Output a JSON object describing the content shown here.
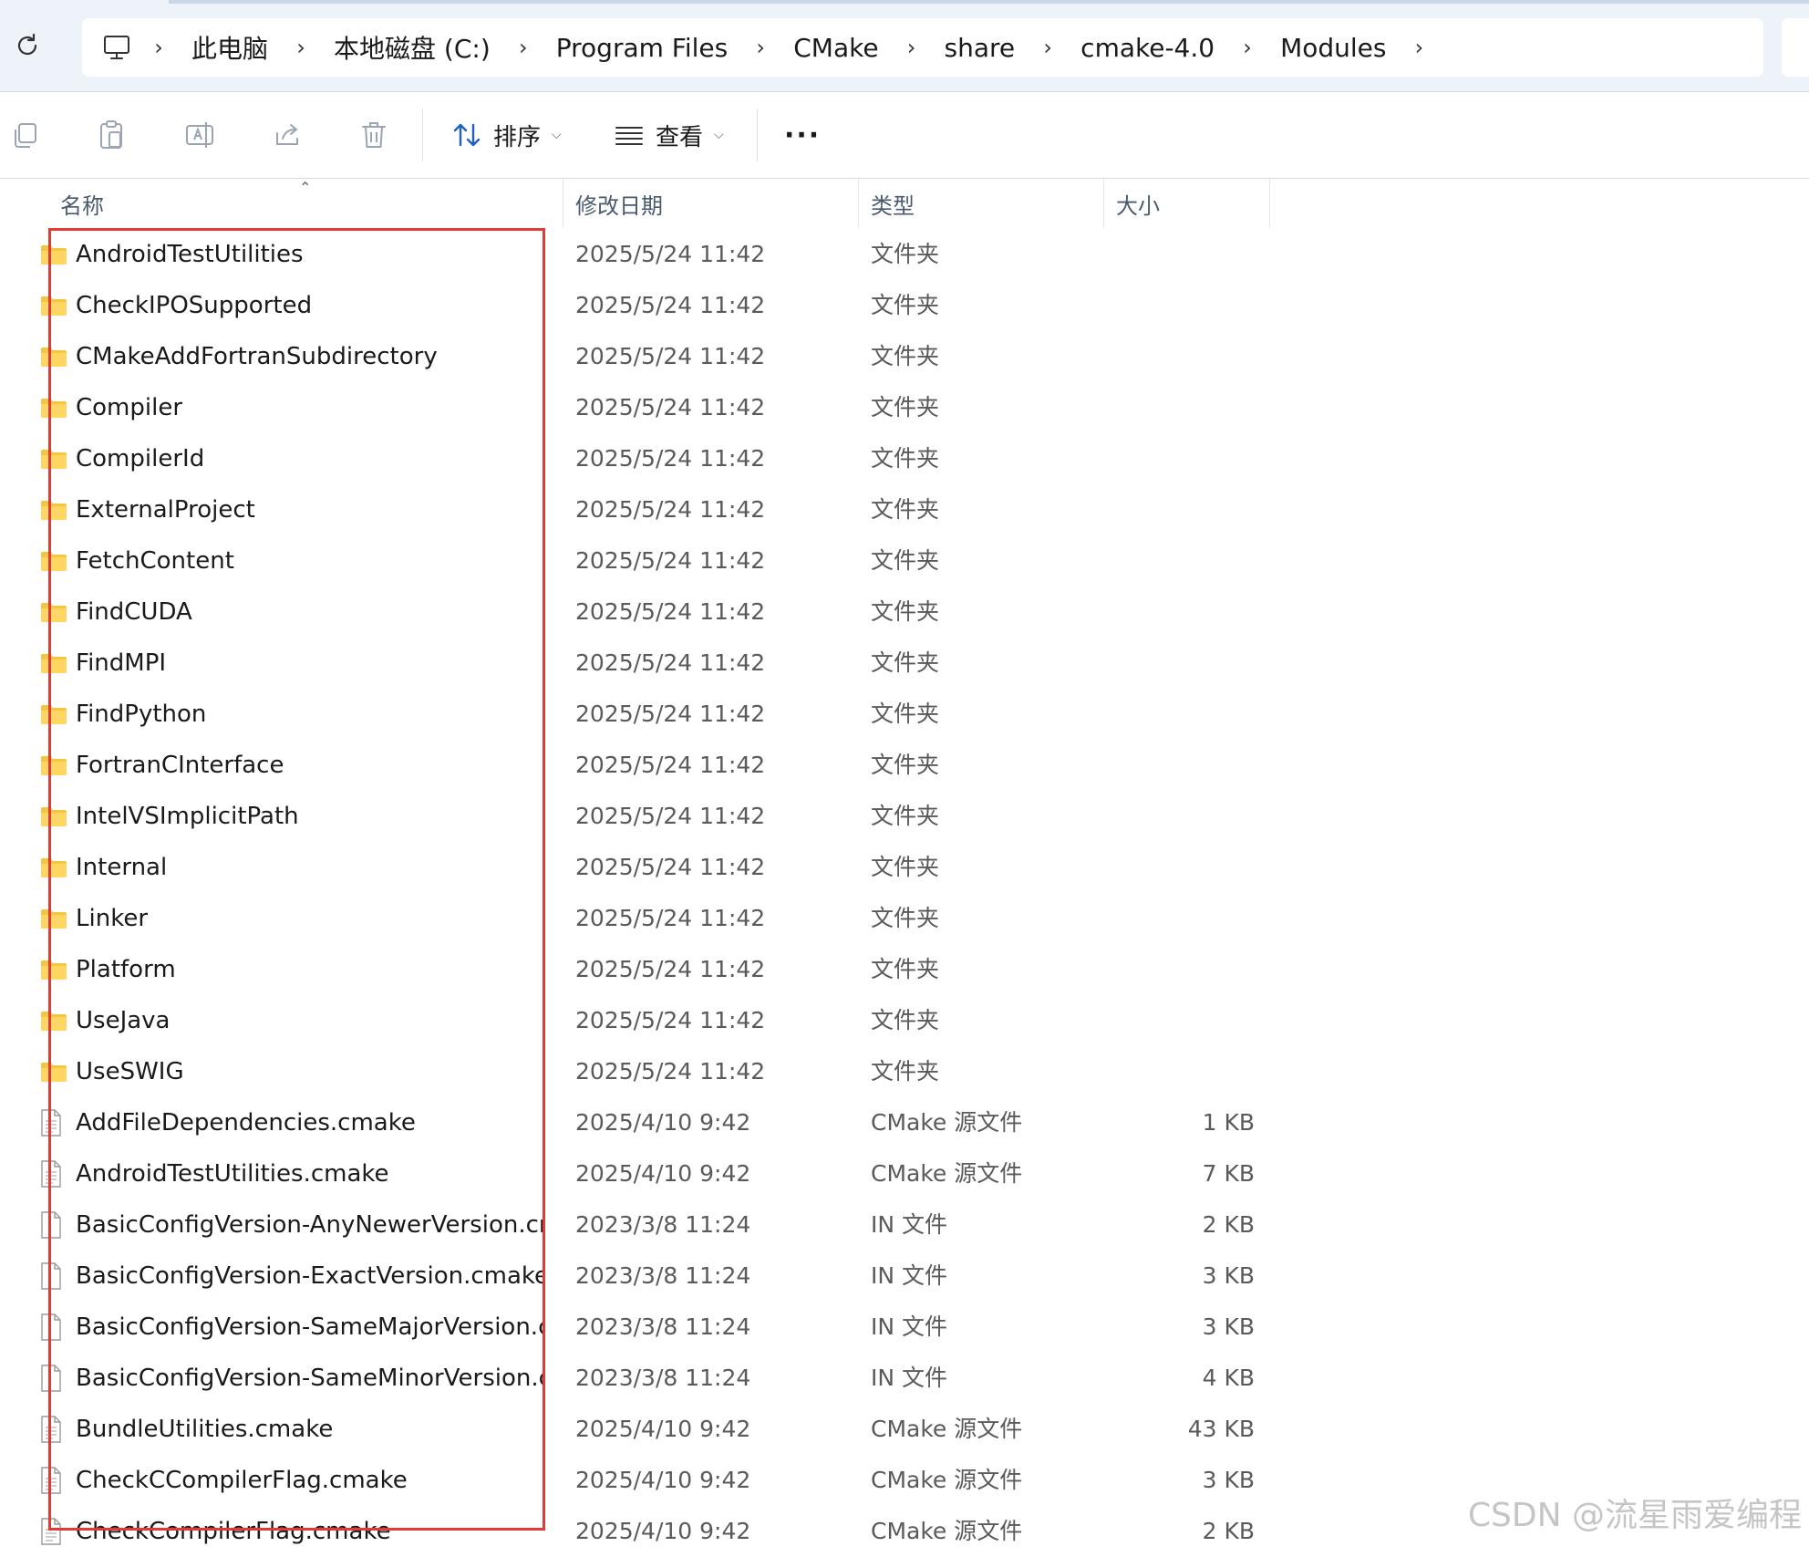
{
  "address": {
    "crumbs": [
      "此电脑",
      "本地磁盘 (C:)",
      "Program Files",
      "CMake",
      "share",
      "cmake-4.0",
      "Modules"
    ]
  },
  "toolbar": {
    "sort_label": "排序",
    "view_label": "查看"
  },
  "columns": {
    "name": "名称",
    "date": "修改日期",
    "type": "类型",
    "size": "大小"
  },
  "files": [
    {
      "name": "AndroidTestUtilities",
      "date": "2025/5/24 11:42",
      "type": "文件夹",
      "size": "",
      "kind": "folder"
    },
    {
      "name": "CheckIPOSupported",
      "date": "2025/5/24 11:42",
      "type": "文件夹",
      "size": "",
      "kind": "folder"
    },
    {
      "name": "CMakeAddFortranSubdirectory",
      "date": "2025/5/24 11:42",
      "type": "文件夹",
      "size": "",
      "kind": "folder"
    },
    {
      "name": "Compiler",
      "date": "2025/5/24 11:42",
      "type": "文件夹",
      "size": "",
      "kind": "folder"
    },
    {
      "name": "CompilerId",
      "date": "2025/5/24 11:42",
      "type": "文件夹",
      "size": "",
      "kind": "folder"
    },
    {
      "name": "ExternalProject",
      "date": "2025/5/24 11:42",
      "type": "文件夹",
      "size": "",
      "kind": "folder"
    },
    {
      "name": "FetchContent",
      "date": "2025/5/24 11:42",
      "type": "文件夹",
      "size": "",
      "kind": "folder"
    },
    {
      "name": "FindCUDA",
      "date": "2025/5/24 11:42",
      "type": "文件夹",
      "size": "",
      "kind": "folder"
    },
    {
      "name": "FindMPI",
      "date": "2025/5/24 11:42",
      "type": "文件夹",
      "size": "",
      "kind": "folder"
    },
    {
      "name": "FindPython",
      "date": "2025/5/24 11:42",
      "type": "文件夹",
      "size": "",
      "kind": "folder"
    },
    {
      "name": "FortranCInterface",
      "date": "2025/5/24 11:42",
      "type": "文件夹",
      "size": "",
      "kind": "folder"
    },
    {
      "name": "IntelVSImplicitPath",
      "date": "2025/5/24 11:42",
      "type": "文件夹",
      "size": "",
      "kind": "folder"
    },
    {
      "name": "Internal",
      "date": "2025/5/24 11:42",
      "type": "文件夹",
      "size": "",
      "kind": "folder"
    },
    {
      "name": "Linker",
      "date": "2025/5/24 11:42",
      "type": "文件夹",
      "size": "",
      "kind": "folder"
    },
    {
      "name": "Platform",
      "date": "2025/5/24 11:42",
      "type": "文件夹",
      "size": "",
      "kind": "folder"
    },
    {
      "name": "UseJava",
      "date": "2025/5/24 11:42",
      "type": "文件夹",
      "size": "",
      "kind": "folder"
    },
    {
      "name": "UseSWIG",
      "date": "2025/5/24 11:42",
      "type": "文件夹",
      "size": "",
      "kind": "folder"
    },
    {
      "name": "AddFileDependencies.cmake",
      "date": "2025/4/10 9:42",
      "type": "CMake 源文件",
      "size": "1 KB",
      "kind": "cmake"
    },
    {
      "name": "AndroidTestUtilities.cmake",
      "date": "2025/4/10 9:42",
      "type": "CMake 源文件",
      "size": "7 KB",
      "kind": "cmake"
    },
    {
      "name": "BasicConfigVersion-AnyNewerVersion.cmak...",
      "date": "2023/3/8 11:24",
      "type": "IN 文件",
      "size": "2 KB",
      "kind": "file"
    },
    {
      "name": "BasicConfigVersion-ExactVersion.cmake.in",
      "date": "2023/3/8 11:24",
      "type": "IN 文件",
      "size": "3 KB",
      "kind": "file"
    },
    {
      "name": "BasicConfigVersion-SameMajorVersion.cma...",
      "date": "2023/3/8 11:24",
      "type": "IN 文件",
      "size": "3 KB",
      "kind": "file"
    },
    {
      "name": "BasicConfigVersion-SameMinorVersion.cma...",
      "date": "2023/3/8 11:24",
      "type": "IN 文件",
      "size": "4 KB",
      "kind": "file"
    },
    {
      "name": "BundleUtilities.cmake",
      "date": "2025/4/10 9:42",
      "type": "CMake 源文件",
      "size": "43 KB",
      "kind": "cmake"
    },
    {
      "name": "CheckCCompilerFlag.cmake",
      "date": "2025/4/10 9:42",
      "type": "CMake 源文件",
      "size": "3 KB",
      "kind": "cmake"
    },
    {
      "name": "CheckCompilerFlag.cmake",
      "date": "2025/4/10 9:42",
      "type": "CMake 源文件",
      "size": "2 KB",
      "kind": "cmake"
    }
  ],
  "watermark": "CSDN @流星雨爱编程",
  "colors": {
    "folder": "#f5c542",
    "highlight": "#e53935",
    "topbar": "#eef3f9"
  }
}
